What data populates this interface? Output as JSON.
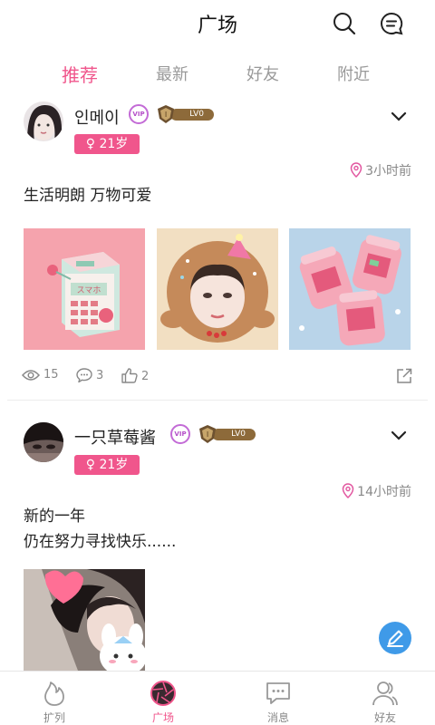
{
  "header": {
    "title": "广场"
  },
  "tabs": [
    {
      "label": "推荐"
    },
    {
      "label": "最新"
    },
    {
      "label": "好友"
    },
    {
      "label": "附近"
    }
  ],
  "posts": [
    {
      "username": "인메이",
      "vip_badge": "VIP",
      "level": "LV0",
      "gender": "♀ 21岁",
      "time": "3小时前",
      "text_lines": [
        "生活明朗 万物可爱"
      ],
      "views": "15",
      "comments": "3",
      "likes": "2"
    },
    {
      "username": "一只草莓酱",
      "vip_badge": "VIP",
      "level": "LV0",
      "gender": "♀ 21岁",
      "time": "14小时前",
      "text_lines": [
        "新的一年",
        "仍在努力寻找快乐......"
      ]
    }
  ],
  "nav": [
    {
      "label": "扩列"
    },
    {
      "label": "广场"
    },
    {
      "label": "消息"
    },
    {
      "label": "好友"
    }
  ],
  "colors": {
    "accent": "#f0568c",
    "fab": "#3f9ae8",
    "level_badge": "#8d6a3a"
  }
}
